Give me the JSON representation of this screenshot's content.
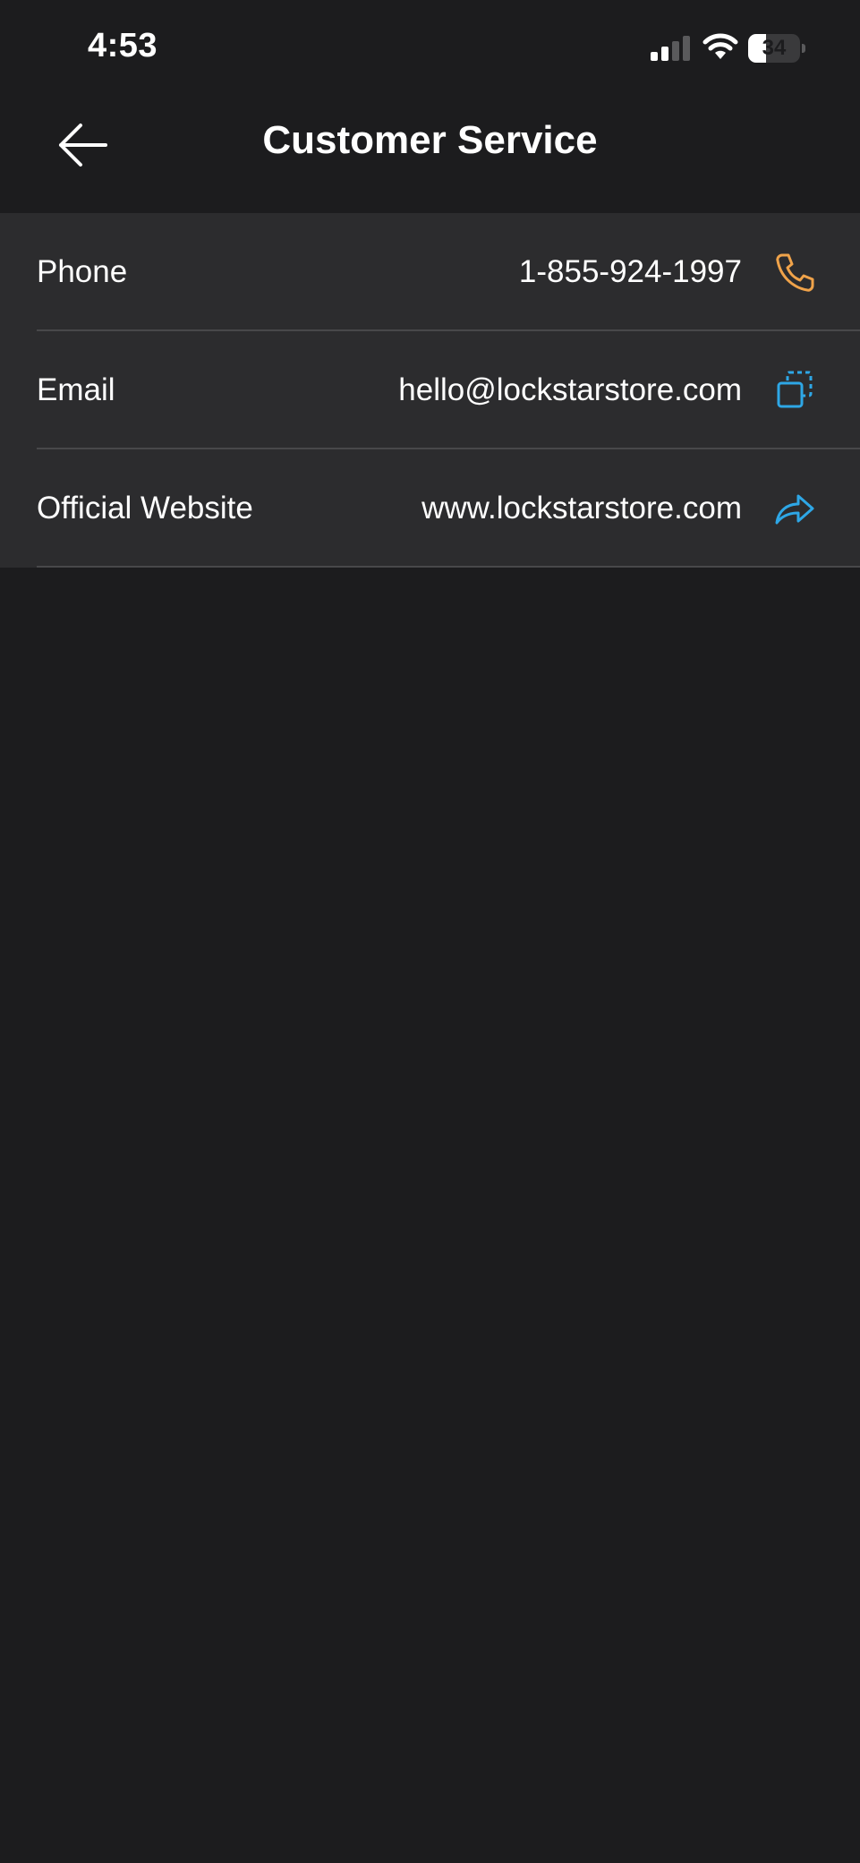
{
  "status_bar": {
    "time": "4:53",
    "battery_level": "34",
    "battery_fraction": 0.34
  },
  "nav": {
    "back_icon": "arrow-left-icon",
    "title": "Customer Service"
  },
  "contacts": [
    {
      "label": "Phone",
      "value": "1-855-924-1997",
      "icon": "phone-icon",
      "icon_color": "#f0a34a"
    },
    {
      "label": "Email",
      "value": "hello@lockstarstore.com",
      "icon": "copy-icon",
      "icon_color": "#2ea7e6"
    },
    {
      "label": "Official Website",
      "value": "www.lockstarstore.com",
      "icon": "share-arrow-icon",
      "icon_color": "#2ea7e6"
    }
  ],
  "colors": {
    "background": "#1c1c1e",
    "row_background": "#2c2c2e",
    "divider": "#48484a",
    "accent_orange": "#f0a34a",
    "accent_blue": "#2ea7e6"
  }
}
